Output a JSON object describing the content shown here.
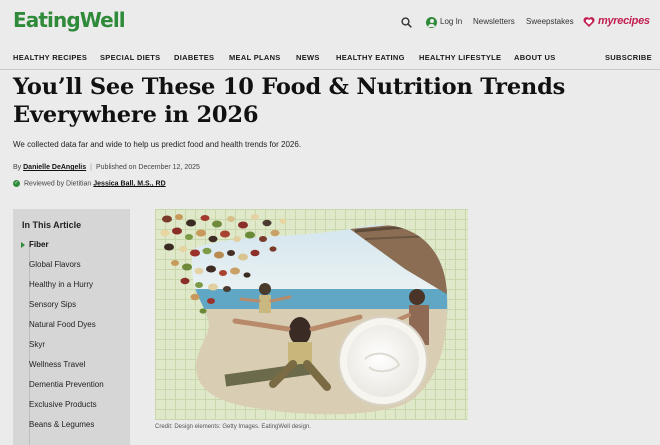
{
  "header": {
    "logo": "EatingWell",
    "login": "Log In",
    "newsletters": "Newsletters",
    "sweepstakes": "Sweepstakes",
    "partner": "myrecipes",
    "search_icon": "search-icon",
    "login_icon": "user-icon",
    "partner_icon": "heart-icon"
  },
  "nav": {
    "items": [
      "HEALTHY RECIPES",
      "SPECIAL DIETS",
      "DIABETES",
      "MEAL PLANS",
      "NEWS",
      "HEALTHY EATING",
      "HEALTHY LIFESTYLE",
      "ABOUT US"
    ],
    "subscribe": "SUBSCRIBE"
  },
  "article": {
    "headline": "You’ll See These 10 Food & Nutrition Trends Everywhere in 2026",
    "dek": "We collected data far and wide to help us predict food and health trends for 2026.",
    "by_prefix": "By",
    "author": "Danielle DeAngelis",
    "published": "Published on December 12, 2025",
    "reviewed_prefix": "Reviewed by Dietitian",
    "reviewer": "Jessica Ball, M.S., RD",
    "image_credit": "Credit: Design elements: Getty Images. EatingWell design."
  },
  "toc": {
    "title": "In This Article",
    "items": [
      "Fiber",
      "Global Flavors",
      "Healthy in a Hurry",
      "Sensory Sips",
      "Natural Food Dyes",
      "Skyr",
      "Wellness Travel",
      "Dementia Prevention",
      "Exclusive Products",
      "Beans & Legumes"
    ],
    "active_index": 0
  },
  "colors": {
    "brand_green": "#2f8a3a",
    "myrecipes_red": "#c21f4f",
    "page_bg": "#ebebeb"
  }
}
